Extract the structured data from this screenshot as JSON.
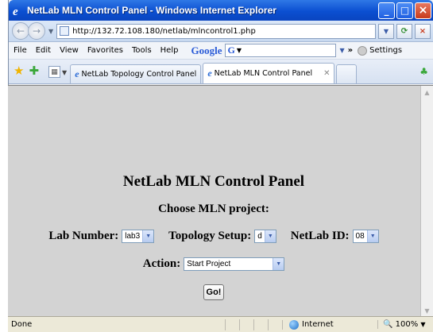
{
  "window": {
    "title": "NetLab MLN Control Panel - Windows Internet Explorer"
  },
  "address": {
    "url": "http://132.72.108.180/netlab/mlncontrol1.php"
  },
  "menu": {
    "items": [
      "File",
      "Edit",
      "View",
      "Favorites",
      "Tools",
      "Help"
    ],
    "google_label": "Google",
    "settings_label": "Settings"
  },
  "tabs": [
    {
      "label": "NetLab Topology Control Panel"
    },
    {
      "label": "NetLab MLN Control Panel"
    }
  ],
  "page": {
    "heading": "NetLab MLN Control Panel",
    "subheading": "Choose MLN project:",
    "lab_number_label": "Lab Number:",
    "lab_number_value": "lab3",
    "topology_label": "Topology Setup:",
    "topology_value": "d",
    "netlab_id_label": "NetLab ID:",
    "netlab_id_value": "08",
    "action_label": "Action:",
    "action_value": "Start Project",
    "go_label": "Go!"
  },
  "status": {
    "text": "Done",
    "zone": "Internet",
    "zoom": "100%"
  },
  "colors": {
    "title_bar": "#0b4fd1",
    "content_bg": "#d3d3d3"
  }
}
